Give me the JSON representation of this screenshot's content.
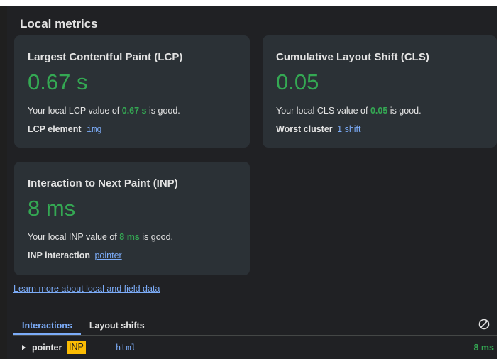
{
  "title": "Local metrics",
  "cards": {
    "lcp": {
      "title": "Largest Contentful Paint (LCP)",
      "value": "0.67 s",
      "desc_prefix": "Your local LCP value of",
      "desc_value": "0.67 s",
      "desc_suffix": "is good.",
      "detail_label": "LCP element",
      "detail_value": "img"
    },
    "cls": {
      "title": "Cumulative Layout Shift (CLS)",
      "value": "0.05",
      "desc_prefix": "Your local CLS value of",
      "desc_value": "0.05",
      "desc_suffix": "is good.",
      "detail_label": "Worst cluster",
      "detail_value": "1 shift"
    },
    "inp": {
      "title": "Interaction to Next Paint (INP)",
      "value": "8 ms",
      "desc_prefix": "Your local INP value of",
      "desc_value": "8 ms",
      "desc_suffix": "is good.",
      "detail_label": "INP interaction",
      "detail_value": "pointer"
    }
  },
  "learn_more": "Learn more about local and field data",
  "tabs": [
    {
      "label": "Interactions",
      "active": true
    },
    {
      "label": "Layout shifts",
      "active": false
    }
  ],
  "interactions": [
    {
      "type": "pointer",
      "badge": "INP",
      "target": "html",
      "duration": "8 ms"
    }
  ],
  "icons": {
    "clear": "clear-icon",
    "expand": "expand-triangle-icon"
  },
  "colors": {
    "good": "#34a853",
    "link": "#7cacf8",
    "card_bg": "#2b3136",
    "panel_bg": "#202124",
    "badge_bg": "#fbbc04"
  }
}
